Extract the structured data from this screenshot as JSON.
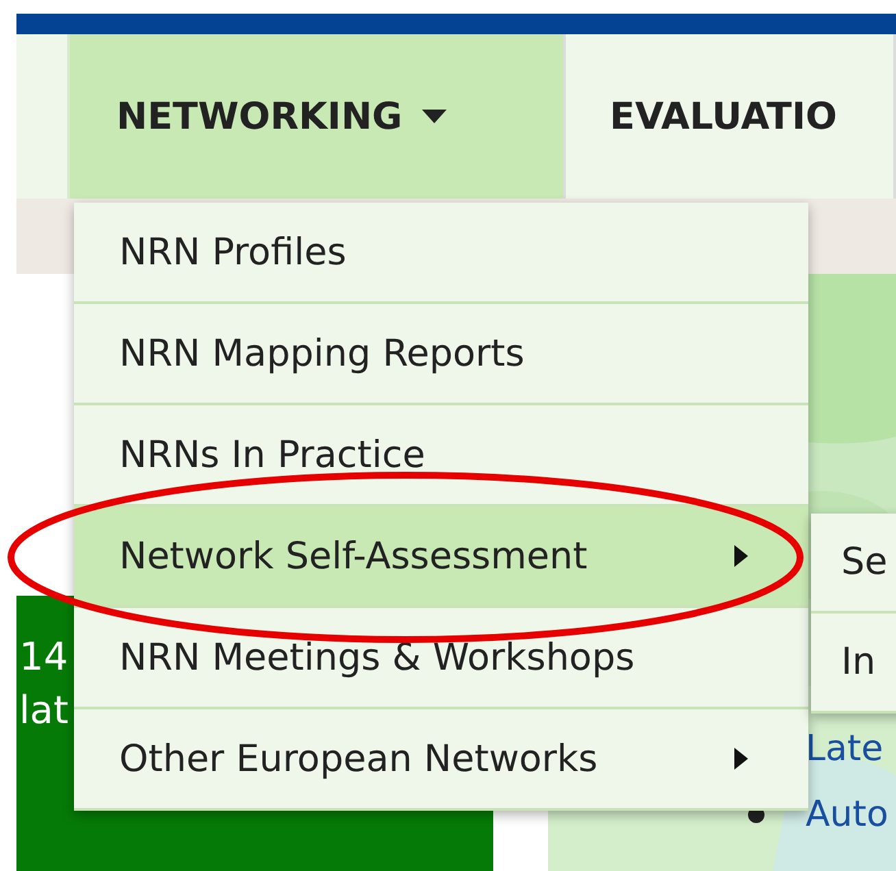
{
  "nav": {
    "tabs": [
      {
        "label": "NETWORKING",
        "selected": true,
        "dropdown": true
      },
      {
        "label": "EVALUATIO",
        "selected": false,
        "dropdown": false
      }
    ]
  },
  "menu": {
    "items": [
      {
        "label": "NRN Profiles",
        "selected": false,
        "submenu": false
      },
      {
        "label": "NRN Mapping Reports",
        "selected": false,
        "submenu": false
      },
      {
        "label": "NRNs In Practice",
        "selected": false,
        "submenu": false
      },
      {
        "label": "Network Self-Assessment",
        "selected": true,
        "submenu": true
      },
      {
        "label": "NRN Meetings & Workshops",
        "selected": false,
        "submenu": false
      },
      {
        "label": "Other European Networks",
        "selected": false,
        "submenu": true
      }
    ]
  },
  "submenu": {
    "items": [
      "Se",
      "In"
    ]
  },
  "banner": {
    "lines": [
      "14",
      "lat"
    ]
  },
  "links": [
    "Late",
    "Auto"
  ],
  "annotation": {
    "kind": "ellipse"
  }
}
